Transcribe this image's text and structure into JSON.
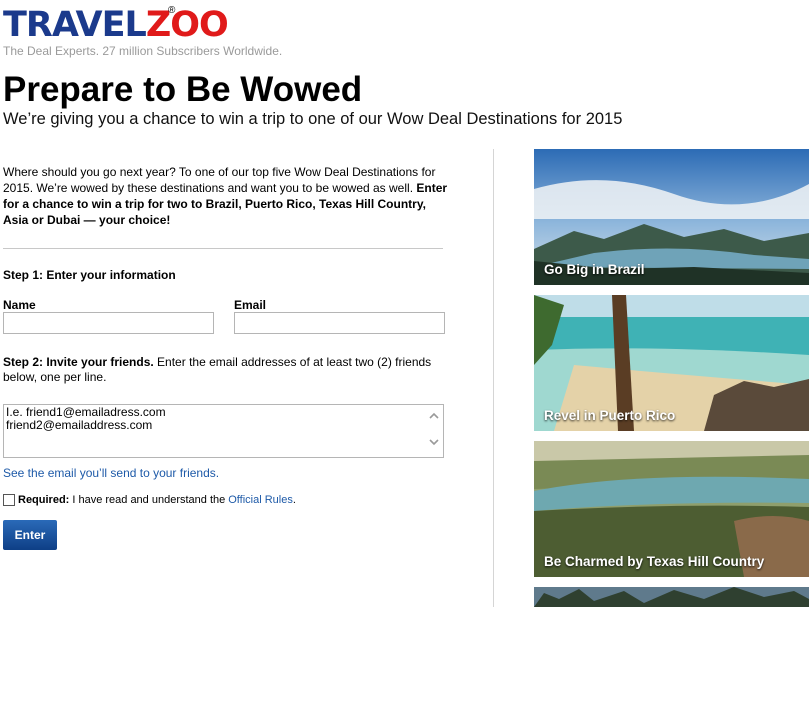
{
  "brand": {
    "logo_part1": "TRAVEL",
    "logo_part2": "ZOO",
    "registered": "®",
    "tagline": "The Deal Experts. 27 million Subscribers Worldwide."
  },
  "headline": "Prepare to Be Wowed",
  "subheadline": "We’re giving you a chance to win a trip to one of our Wow Deal Destinations for 2015",
  "intro": {
    "text": "Where should you go next year? To one of our top five Wow Deal Destinations for 2015. We’re wowed by these destinations and want you to be wowed as well.",
    "bold": "Enter for a chance to win a trip for two to Brazil, Puerto Rico, Texas Hill Country, Asia or Dubai — your choice!"
  },
  "step1": {
    "heading": "Step 1: Enter your information",
    "name_label": "Name",
    "name_value": "",
    "email_label": "Email",
    "email_value": ""
  },
  "step2": {
    "heading": "Step 2: Invite your friends.",
    "instructions": "Enter the email addresses of at least two (2) friends below, one per line.",
    "textarea_lines": [
      "I.e. friend1@emailadress.com",
      "friend2@emailaddress.com"
    ]
  },
  "email_preview_link": "See the email you’ll send to your friends.",
  "required": {
    "label": "Required:",
    "text": "I have read and understand the",
    "link": "Official Rules",
    "suffix": ".",
    "checked": false
  },
  "submit_label": "Enter",
  "destinations": [
    {
      "caption": "Go Big in Brazil",
      "icon": "brazil-landscape-photo"
    },
    {
      "caption": "Revel in Puerto Rico",
      "icon": "puerto-rico-beach-photo"
    },
    {
      "caption": "Be Charmed by Texas Hill Country",
      "icon": "texas-hill-country-photo"
    },
    {
      "caption": "",
      "icon": "asia-karst-photo"
    }
  ],
  "colors": {
    "logo_blue": "#1b3a8c",
    "logo_red": "#e01a1a",
    "link_blue": "#1e5aa8",
    "button_blue": "#1a4f9a"
  }
}
